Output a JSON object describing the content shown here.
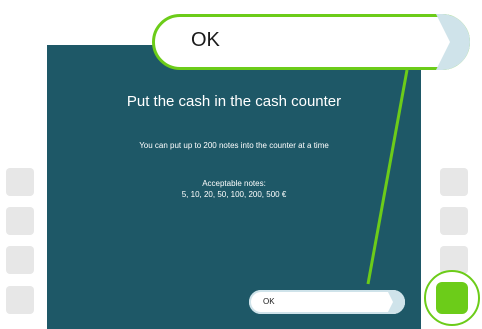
{
  "callout": {
    "label": "OK"
  },
  "screen": {
    "title": "Put the cash in the cash counter",
    "subtitle": "You can put up to 200 notes into the counter at a time",
    "notes_label": "Acceptable notes:",
    "notes_value": "5, 10, 20, 50, 100, 200, 500 €",
    "ok_label": "OK"
  },
  "colors": {
    "screen_bg": "#1e5867",
    "accent_green": "#6ccc19",
    "side_button": "#e7e7e7",
    "chevron": "#cfe3ea"
  }
}
